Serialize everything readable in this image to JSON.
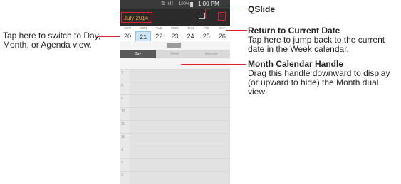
{
  "phone": {
    "status_bar": {
      "signal_icons": "⇅ ıll",
      "battery_text": "100%",
      "time": "1:00 PM"
    },
    "header": {
      "month_label": "July 2014",
      "today_label": "□"
    },
    "week": {
      "weekdays": [
        "SUN",
        "MON",
        "TUE",
        "WED",
        "THU",
        "FRI",
        "SAT"
      ],
      "dates": [
        "20",
        "21",
        "22",
        "23",
        "24",
        "25",
        "26"
      ],
      "selected_index": 1
    },
    "view_tabs": [
      "Day",
      "Week",
      "Agenda"
    ],
    "hour_labels": [
      "7",
      "8",
      "9",
      "10",
      "11",
      "12",
      "1",
      "2",
      "3"
    ]
  },
  "callouts": {
    "switch_view": {
      "text": "Tap here to switch to Day, Month, or Agenda view."
    },
    "qslide": {
      "title": "QSlide"
    },
    "return_date": {
      "title": "Return to Current Date",
      "description": "Tap here to jump back to the current date in the Week calendar."
    },
    "month_handle": {
      "title": "Month Calendar Handle",
      "description": "Drag this handle downward to display (or upward to hide) the Month dual view."
    }
  },
  "colors": {
    "callout_line": "#d9232d",
    "month_label": "#f0a030",
    "header_bg": "#2b2b2b"
  }
}
